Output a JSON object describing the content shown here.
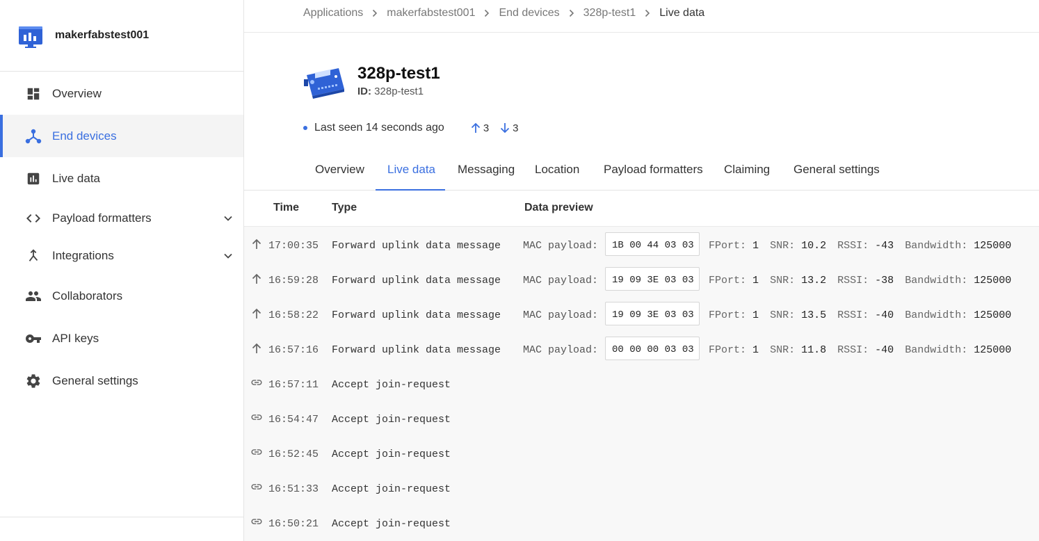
{
  "app": {
    "name": "makerfabstest001"
  },
  "sidebar": {
    "items": [
      {
        "label": "Overview",
        "icon": "dashboard-icon",
        "active": false
      },
      {
        "label": "End devices",
        "icon": "device-nodes-icon",
        "active": true
      },
      {
        "label": "Live data",
        "icon": "bar-chart-icon",
        "active": false
      },
      {
        "label": "Payload formatters",
        "icon": "code-icon",
        "active": false,
        "expandable": true
      },
      {
        "label": "Integrations",
        "icon": "merge-icon",
        "active": false,
        "expandable": true
      },
      {
        "label": "Collaborators",
        "icon": "people-icon",
        "active": false
      },
      {
        "label": "API keys",
        "icon": "key-icon",
        "active": false
      },
      {
        "label": "General settings",
        "icon": "gear-icon",
        "active": false
      }
    ]
  },
  "breadcrumb": [
    "Applications",
    "makerfabstest001",
    "End devices",
    "328p-test1",
    "Live data"
  ],
  "device": {
    "name": "328p-test1",
    "id_label": "ID:",
    "id": "328p-test1",
    "last_seen": "Last seen 14 seconds ago",
    "uplink_count": "3",
    "downlink_count": "3"
  },
  "tabs": [
    "Overview",
    "Live data",
    "Messaging",
    "Location",
    "Payload formatters",
    "Claiming",
    "General settings"
  ],
  "active_tab": "Live data",
  "table": {
    "headers": {
      "time": "Time",
      "type": "Type",
      "preview": "Data preview"
    },
    "rows": [
      {
        "kind": "uplink",
        "time": "17:00:35",
        "type": "Forward uplink data message",
        "mac_label": "MAC payload:",
        "mac": "1B 00 44 03 03",
        "fport_k": "FPort:",
        "fport": "1",
        "snr_k": "SNR:",
        "snr": "10.2",
        "rssi_k": "RSSI:",
        "rssi": "-43",
        "bw_k": "Bandwidth:",
        "bw": "125000"
      },
      {
        "kind": "uplink",
        "time": "16:59:28",
        "type": "Forward uplink data message",
        "mac_label": "MAC payload:",
        "mac": "19 09 3E 03 03",
        "fport_k": "FPort:",
        "fport": "1",
        "snr_k": "SNR:",
        "snr": "13.2",
        "rssi_k": "RSSI:",
        "rssi": "-38",
        "bw_k": "Bandwidth:",
        "bw": "125000"
      },
      {
        "kind": "uplink",
        "time": "16:58:22",
        "type": "Forward uplink data message",
        "mac_label": "MAC payload:",
        "mac": "19 09 3E 03 03",
        "fport_k": "FPort:",
        "fport": "1",
        "snr_k": "SNR:",
        "snr": "13.5",
        "rssi_k": "RSSI:",
        "rssi": "-40",
        "bw_k": "Bandwidth:",
        "bw": "125000"
      },
      {
        "kind": "uplink",
        "time": "16:57:16",
        "type": "Forward uplink data message",
        "mac_label": "MAC payload:",
        "mac": "00 00 00 03 03",
        "fport_k": "FPort:",
        "fport": "1",
        "snr_k": "SNR:",
        "snr": "11.8",
        "rssi_k": "RSSI:",
        "rssi": "-40",
        "bw_k": "Bandwidth:",
        "bw": "125000"
      },
      {
        "kind": "join",
        "time": "16:57:11",
        "type": "Accept join-request"
      },
      {
        "kind": "join",
        "time": "16:54:47",
        "type": "Accept join-request"
      },
      {
        "kind": "join",
        "time": "16:52:45",
        "type": "Accept join-request"
      },
      {
        "kind": "join",
        "time": "16:51:33",
        "type": "Accept join-request"
      },
      {
        "kind": "join",
        "time": "16:50:21",
        "type": "Accept join-request"
      }
    ]
  },
  "colors": {
    "accent": "#3a6fe0",
    "icon_gray": "#444444"
  }
}
